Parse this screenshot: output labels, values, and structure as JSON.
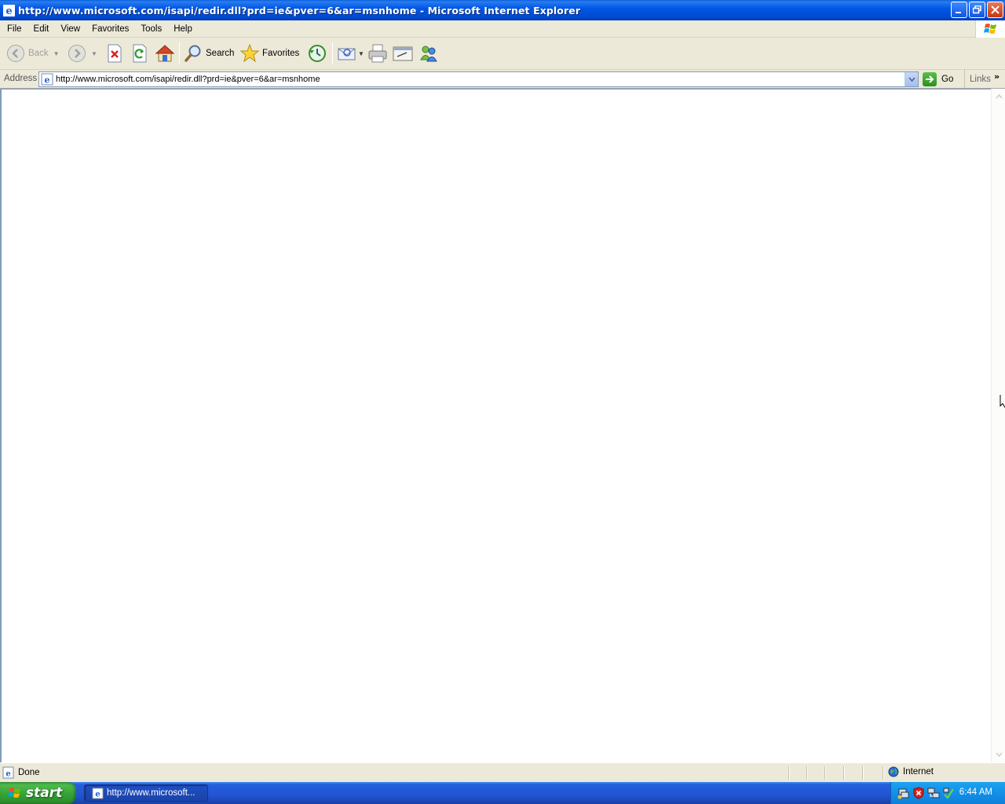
{
  "window": {
    "title": "http://www.microsoft.com/isapi/redir.dll?prd=ie&pver=6&ar=msnhome - Microsoft Internet Explorer"
  },
  "menu": {
    "items": [
      "File",
      "Edit",
      "View",
      "Favorites",
      "Tools",
      "Help"
    ]
  },
  "toolbar": {
    "back_label": "Back",
    "search_label": "Search",
    "favorites_label": "Favorites",
    "icons": [
      "back-icon",
      "forward-icon",
      "stop-icon",
      "refresh-icon",
      "home-icon",
      "search-icon",
      "favorites-star-icon",
      "history-icon",
      "mail-icon",
      "print-icon",
      "edit-icon",
      "messenger-icon"
    ]
  },
  "address": {
    "label": "Address",
    "url": "http://www.microsoft.com/isapi/redir.dll?prd=ie&pver=6&ar=msnhome",
    "go_label": "Go",
    "links_label": "Links"
  },
  "status": {
    "text": "Done",
    "zone": "Internet"
  },
  "taskbar": {
    "start_label": "start",
    "task_label": "http://www.microsoft...",
    "clock": "6:44 AM"
  },
  "colors": {
    "titlebar": "#0058e6",
    "taskbar": "#245edb",
    "start_button": "#3c9e3c",
    "chrome": "#ece9d8"
  }
}
